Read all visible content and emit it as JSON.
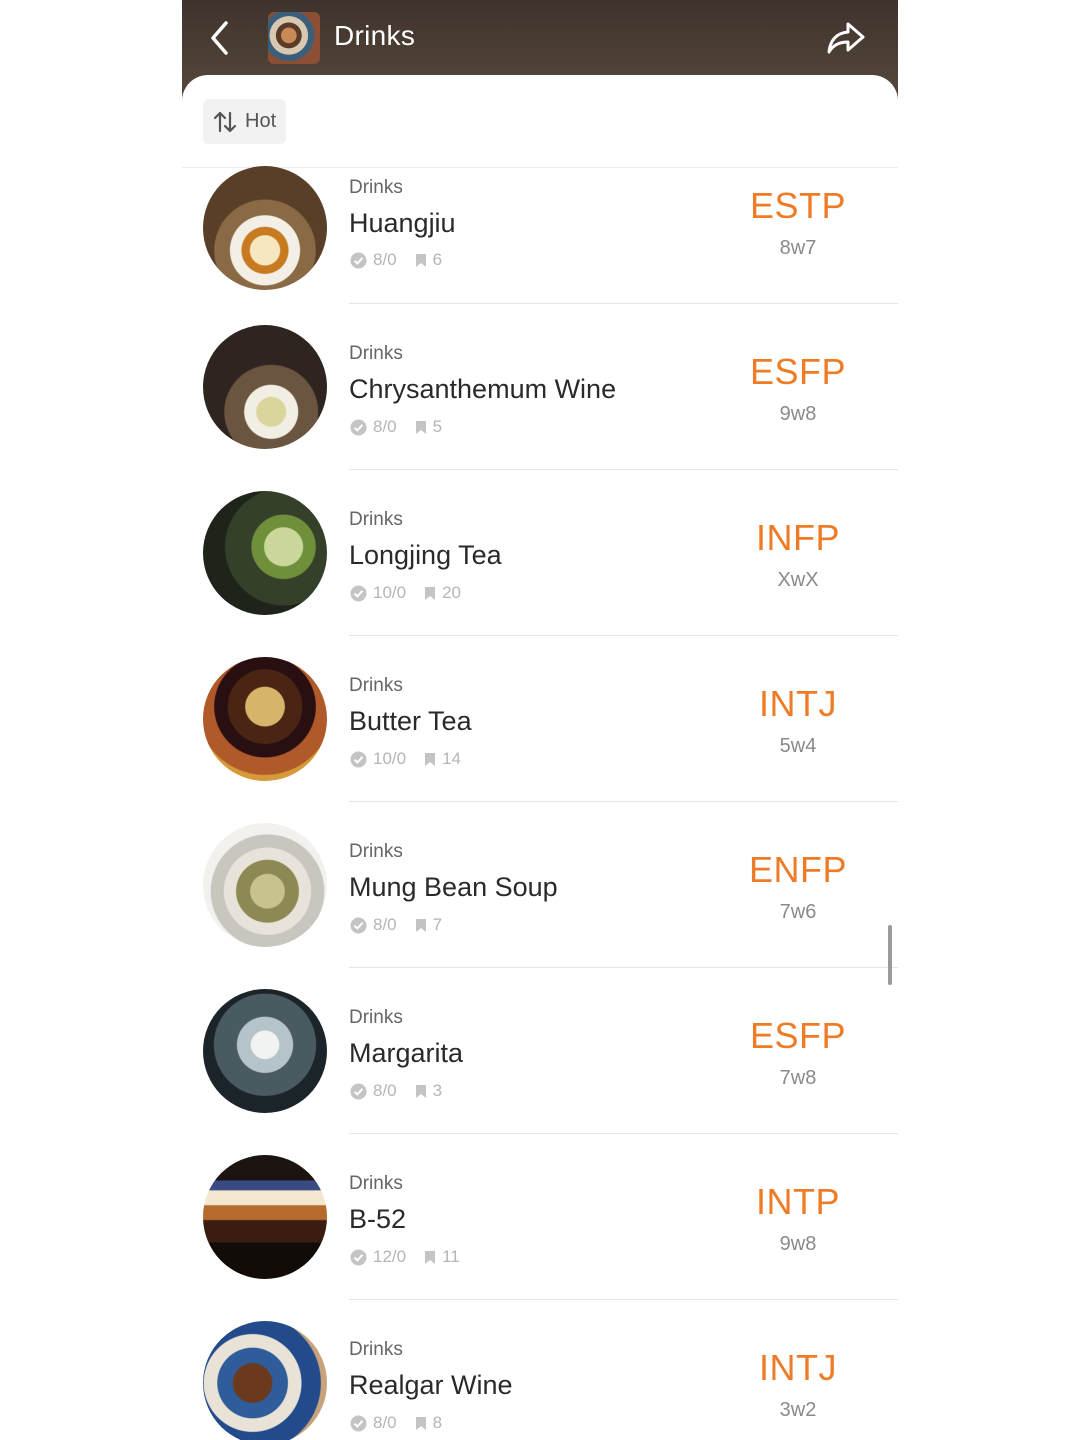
{
  "header": {
    "title": "Drinks",
    "back_icon": "chevron-left-icon",
    "share_icon": "share-arrow-icon"
  },
  "sort": {
    "label": "Hot",
    "icon": "sort-arrows-icon"
  },
  "accent_color": "#ee7c27",
  "items": [
    {
      "category": "Drinks",
      "name": "Huangjiu",
      "votes": "8/0",
      "saves": "6",
      "mbti": "ESTP",
      "wing": "8w7"
    },
    {
      "category": "Drinks",
      "name": "Chrysanthemum Wine",
      "votes": "8/0",
      "saves": "5",
      "mbti": "ESFP",
      "wing": "9w8"
    },
    {
      "category": "Drinks",
      "name": "Longjing Tea",
      "votes": "10/0",
      "saves": "20",
      "mbti": "INFP",
      "wing": "XwX"
    },
    {
      "category": "Drinks",
      "name": "Butter Tea",
      "votes": "10/0",
      "saves": "14",
      "mbti": "INTJ",
      "wing": "5w4"
    },
    {
      "category": "Drinks",
      "name": "Mung Bean Soup",
      "votes": "8/0",
      "saves": "7",
      "mbti": "ENFP",
      "wing": "7w6"
    },
    {
      "category": "Drinks",
      "name": "Margarita",
      "votes": "8/0",
      "saves": "3",
      "mbti": "ESFP",
      "wing": "7w8"
    },
    {
      "category": "Drinks",
      "name": "B-52",
      "votes": "12/0",
      "saves": "11",
      "mbti": "INTP",
      "wing": "9w8"
    },
    {
      "category": "Drinks",
      "name": "Realgar Wine",
      "votes": "8/0",
      "saves": "8",
      "mbti": "INTJ",
      "wing": "3w2"
    }
  ]
}
